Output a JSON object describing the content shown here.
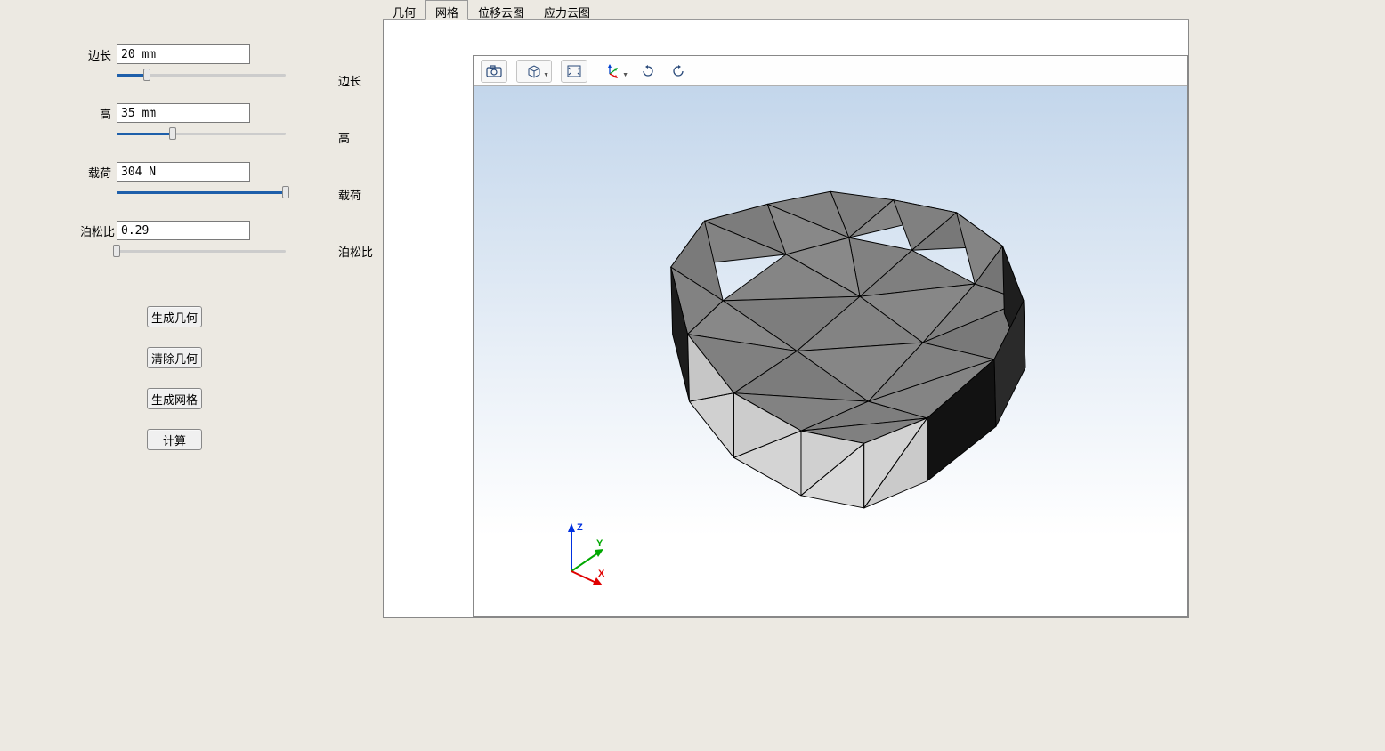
{
  "tabs": {
    "geometry": "几何",
    "mesh": "网格",
    "displacement": "位移云图",
    "stress": "应力云图",
    "active": "mesh"
  },
  "params": {
    "edge": {
      "label": "边长",
      "value": "20 mm",
      "pct": 18
    },
    "height": {
      "label": "高",
      "value": "35 mm",
      "pct": 33
    },
    "load": {
      "label": "载荷",
      "value": "304 N",
      "pct": 100
    },
    "poisson": {
      "label": "泊松比",
      "value": "0.29",
      "pct": 0
    }
  },
  "midLabels": {
    "edge": "边长",
    "height": "高",
    "load": "载荷",
    "poisson": "泊松比"
  },
  "buttons": {
    "genGeometry": "生成几何",
    "clearGeometry": "清除几何",
    "genMesh": "生成网格",
    "compute": "计算"
  },
  "triad": {
    "x": "X",
    "y": "Y",
    "z": "Z"
  }
}
